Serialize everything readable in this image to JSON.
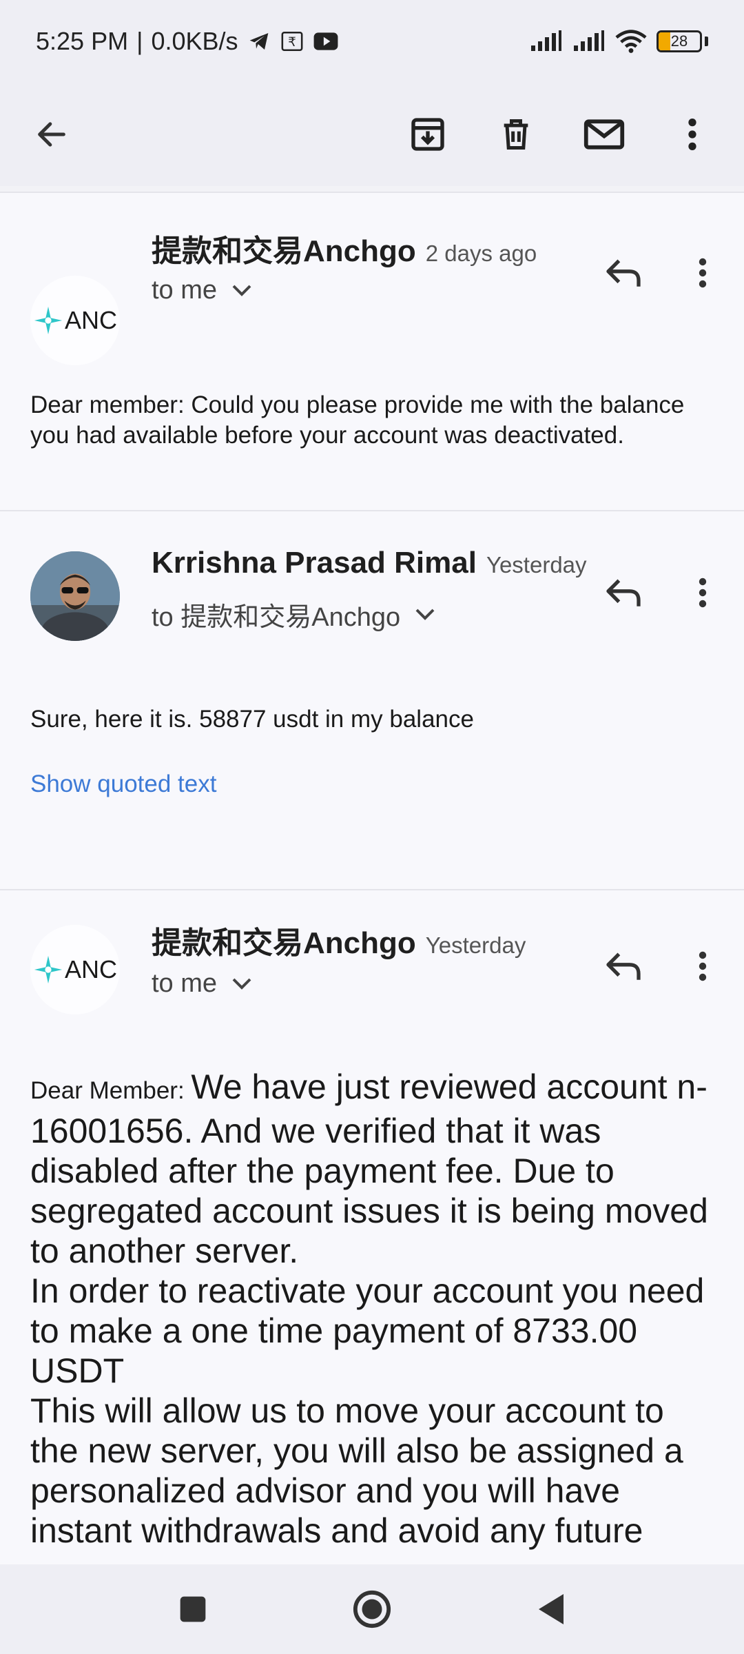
{
  "status_bar": {
    "time": "5:25 PM",
    "speed": "0.0KB/s",
    "battery": "28",
    "icons": [
      "telegram-icon",
      "rupee-icon",
      "youtube-icon",
      "signal-icon",
      "signal-icon",
      "wifi-icon",
      "battery-icon"
    ]
  },
  "toolbar": {
    "icons": [
      "back-arrow-icon",
      "archive-icon",
      "delete-icon",
      "mark-unread-icon",
      "more-vert-icon"
    ]
  },
  "messages": [
    {
      "sender": "提款和交易Anchgo",
      "time": "2 days ago",
      "recipient": "to me",
      "avatar_text": "ANC",
      "body": "Dear member: Could you please provide me with the balance you had available before your account was deactivated."
    },
    {
      "sender": "Krrishna Prasad Rimal",
      "time": "Yesterday",
      "recipient": "to 提款和交易Anchgo",
      "body": "Sure, here it is.  58877 usdt in my balance",
      "show_quoted": "Show quoted text"
    },
    {
      "sender": "提款和交易Anchgo",
      "time": "Yesterday",
      "recipient": "to me",
      "avatar_text": "ANC",
      "body_prefix": "Dear Member: ",
      "body": "We have just reviewed account n-16001656. And we verified that it was disabled after the payment fee. Due to segregated account issues it is being moved to another server.",
      "body_2": "In order to reactivate your account you need to make a one time payment of 8733.00 USDT",
      "body_3": "This will allow us to move your account to the new server, you will also be assigned a personalized advisor and you will have instant withdrawals and avoid any future"
    }
  ],
  "colors": {
    "background": "#f8f8fc",
    "bars": "#eeeef4",
    "link": "#3d7ad6",
    "battery_fill": "#f2a900",
    "anc_logo": "#2ec6c9"
  }
}
